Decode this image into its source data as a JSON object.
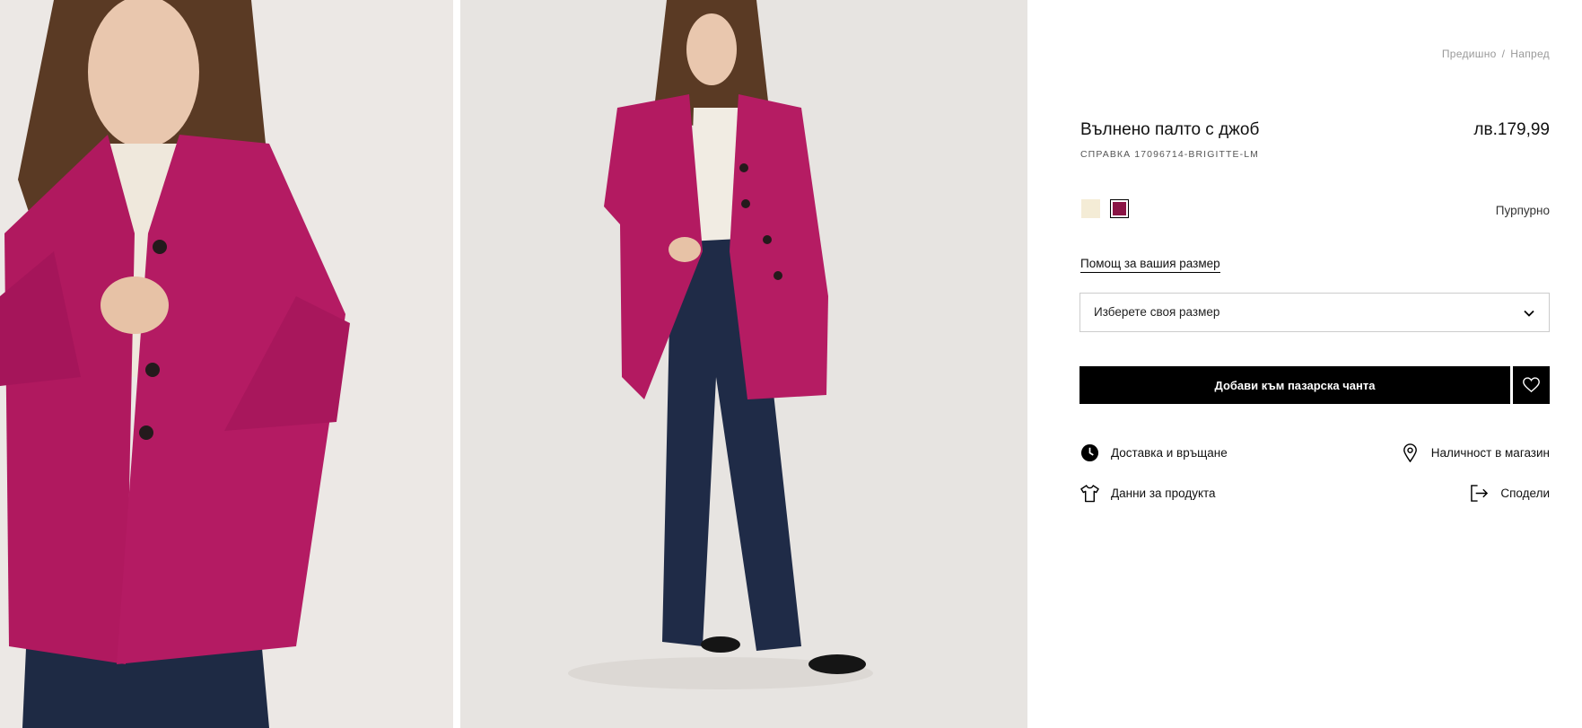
{
  "gallery": {
    "images": [
      {
        "alt": "close-up of model wearing magenta wool coat"
      },
      {
        "alt": "full-length model in magenta wool coat and dark flared jeans"
      }
    ]
  },
  "pager": {
    "prev": "Предишно",
    "separator": "/",
    "next": "Напред"
  },
  "product": {
    "title": "Вълнено палто с джоб",
    "price": "лв.179,99",
    "reference": "СПРАВКА 17096714-BRIGITTE-LM"
  },
  "colors": {
    "swatches": [
      {
        "color": "#f4ecd6",
        "selected": false
      },
      {
        "color": "#8a1545",
        "selected": true
      }
    ],
    "selected_name": "Пурпурно"
  },
  "size": {
    "help_label": "Помощ за вашия размер",
    "select_label": "Изберете своя размер"
  },
  "actions": {
    "add_to_bag": "Добави към пазарска чанта",
    "wishlist_icon": "heart-icon"
  },
  "links": {
    "delivery": {
      "label": "Доставка и връщане",
      "icon": "clock-icon"
    },
    "store": {
      "label": "Наличност в магазин",
      "icon": "location-pin-icon"
    },
    "details": {
      "label": "Данни за продукта",
      "icon": "tshirt-icon"
    },
    "share": {
      "label": "Сподели",
      "icon": "share-exit-icon"
    }
  }
}
